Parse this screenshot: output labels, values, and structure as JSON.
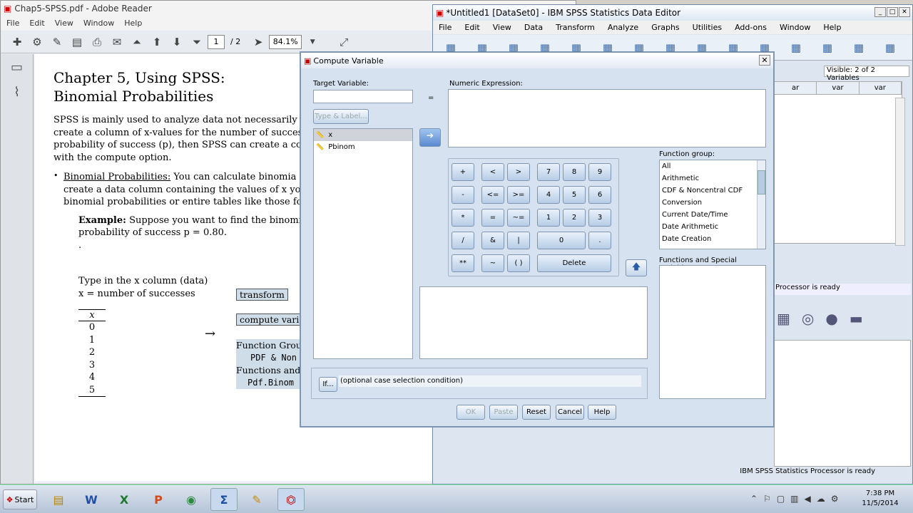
{
  "adobe": {
    "title": "Chap5-SPSS.pdf - Adobe Reader",
    "menu": [
      "File",
      "Edit",
      "View",
      "Window",
      "Help"
    ],
    "page_current": "1",
    "page_total": "/ 2",
    "zoom": "84.1%",
    "pdf": {
      "heading_line1": "Chapter 5, Using SPSS:",
      "heading_line2": "Binomial Probabilities",
      "para1": [
        "SPSS is mainly used to analyze data not necessarily ca",
        "create a column of x-values for the number of successes",
        "probability of success (p), then SPSS can create a colun",
        "with the compute option."
      ],
      "bullet_title": "Binomial Probabilities:",
      "bullet_lines": [
        "You can calculate binomia",
        "create a data column containing the values of x yo",
        "binomial probabilities or entire tables like those fo"
      ],
      "example_label": "Example:",
      "example_lines": [
        "Suppose you want to find the binomi",
        "probability of success p = 0.80."
      ],
      "dot": ".",
      "type_lines": [
        "Type in the x column (data)",
        "x = number of successes"
      ],
      "col_header": "x",
      "col_values": [
        "0",
        "1",
        "2",
        "3",
        "4",
        "5"
      ],
      "arrow": "→",
      "step_transform": "transform",
      "step_compute": "compute varis",
      "step_fg": "Function Grou",
      "step_pdf": "PDF & Non",
      "step_fsv": "Functions and S",
      "step_pdfbinom": "Pdf.Binom"
    }
  },
  "spss": {
    "title": "*Untitled1 [DataSet0] - IBM SPSS Statistics Data Editor",
    "menu": [
      "File",
      "Edit",
      "View",
      "Data",
      "Transform",
      "Analyze",
      "Graphs",
      "Utilities",
      "Add-ons",
      "Window",
      "Help"
    ],
    "visible": "Visible: 2 of 2 Variables",
    "col_headers": [
      "ar",
      "var",
      "var"
    ],
    "status1": "Processor is ready",
    "status2": "IBM SPSS Statistics Processor is ready"
  },
  "dialog": {
    "title": "Compute Variable",
    "target_label": "Target Variable:",
    "target_value": "",
    "equals": "=",
    "type_label_btn": "Type & Label...",
    "numeric_label": "Numeric Expression:",
    "variables": [
      "x",
      "Pbinom"
    ],
    "calc": {
      "row1": [
        "+",
        "<",
        ">",
        "7",
        "8",
        "9"
      ],
      "row2": [
        "-",
        "<=",
        ">=",
        "4",
        "5",
        "6"
      ],
      "row3": [
        "*",
        "=",
        "~=",
        "1",
        "2",
        "3"
      ],
      "row4": [
        "/",
        "&",
        "|",
        "0",
        "."
      ],
      "row5": [
        "**",
        "~",
        "( )",
        "Delete"
      ]
    },
    "function_group_label": "Function group:",
    "function_groups": [
      "All",
      "Arithmetic",
      "CDF & Noncentral CDF",
      "Conversion",
      "Current Date/Time",
      "Date Arithmetic",
      "Date Creation"
    ],
    "functions_label": "Functions and Special Variables:",
    "if_btn": "If...",
    "if_text": "(optional case selection condition)",
    "buttons": [
      "OK",
      "Paste",
      "Reset",
      "Cancel",
      "Help"
    ]
  },
  "taskbar": {
    "start": "Start",
    "time": "7:38 PM",
    "date": "11/5/2014"
  }
}
